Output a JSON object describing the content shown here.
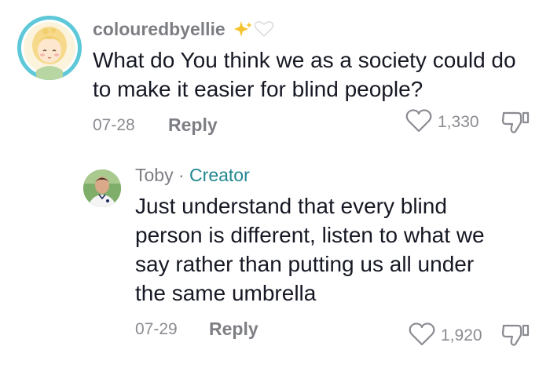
{
  "comments": [
    {
      "username": "colouredbyellie",
      "text": "What do You think we as a society could do to make it easier for blind people?",
      "date": "07-28",
      "reply_label": "Reply",
      "likes": "1,330",
      "badge_emojis": "✨🤍"
    },
    {
      "username": "Toby",
      "separator": "·",
      "creator_label": "Creator",
      "text": "Just understand that every blind person is different, listen to what we say rather than putting us all under the same umbrella",
      "date": "07-29",
      "reply_label": "Reply",
      "likes": "1,920"
    }
  ],
  "colors": {
    "avatar_ring": "#5ec8d8",
    "creator_accent": "#20888f",
    "muted_text": "#8a8b91"
  }
}
